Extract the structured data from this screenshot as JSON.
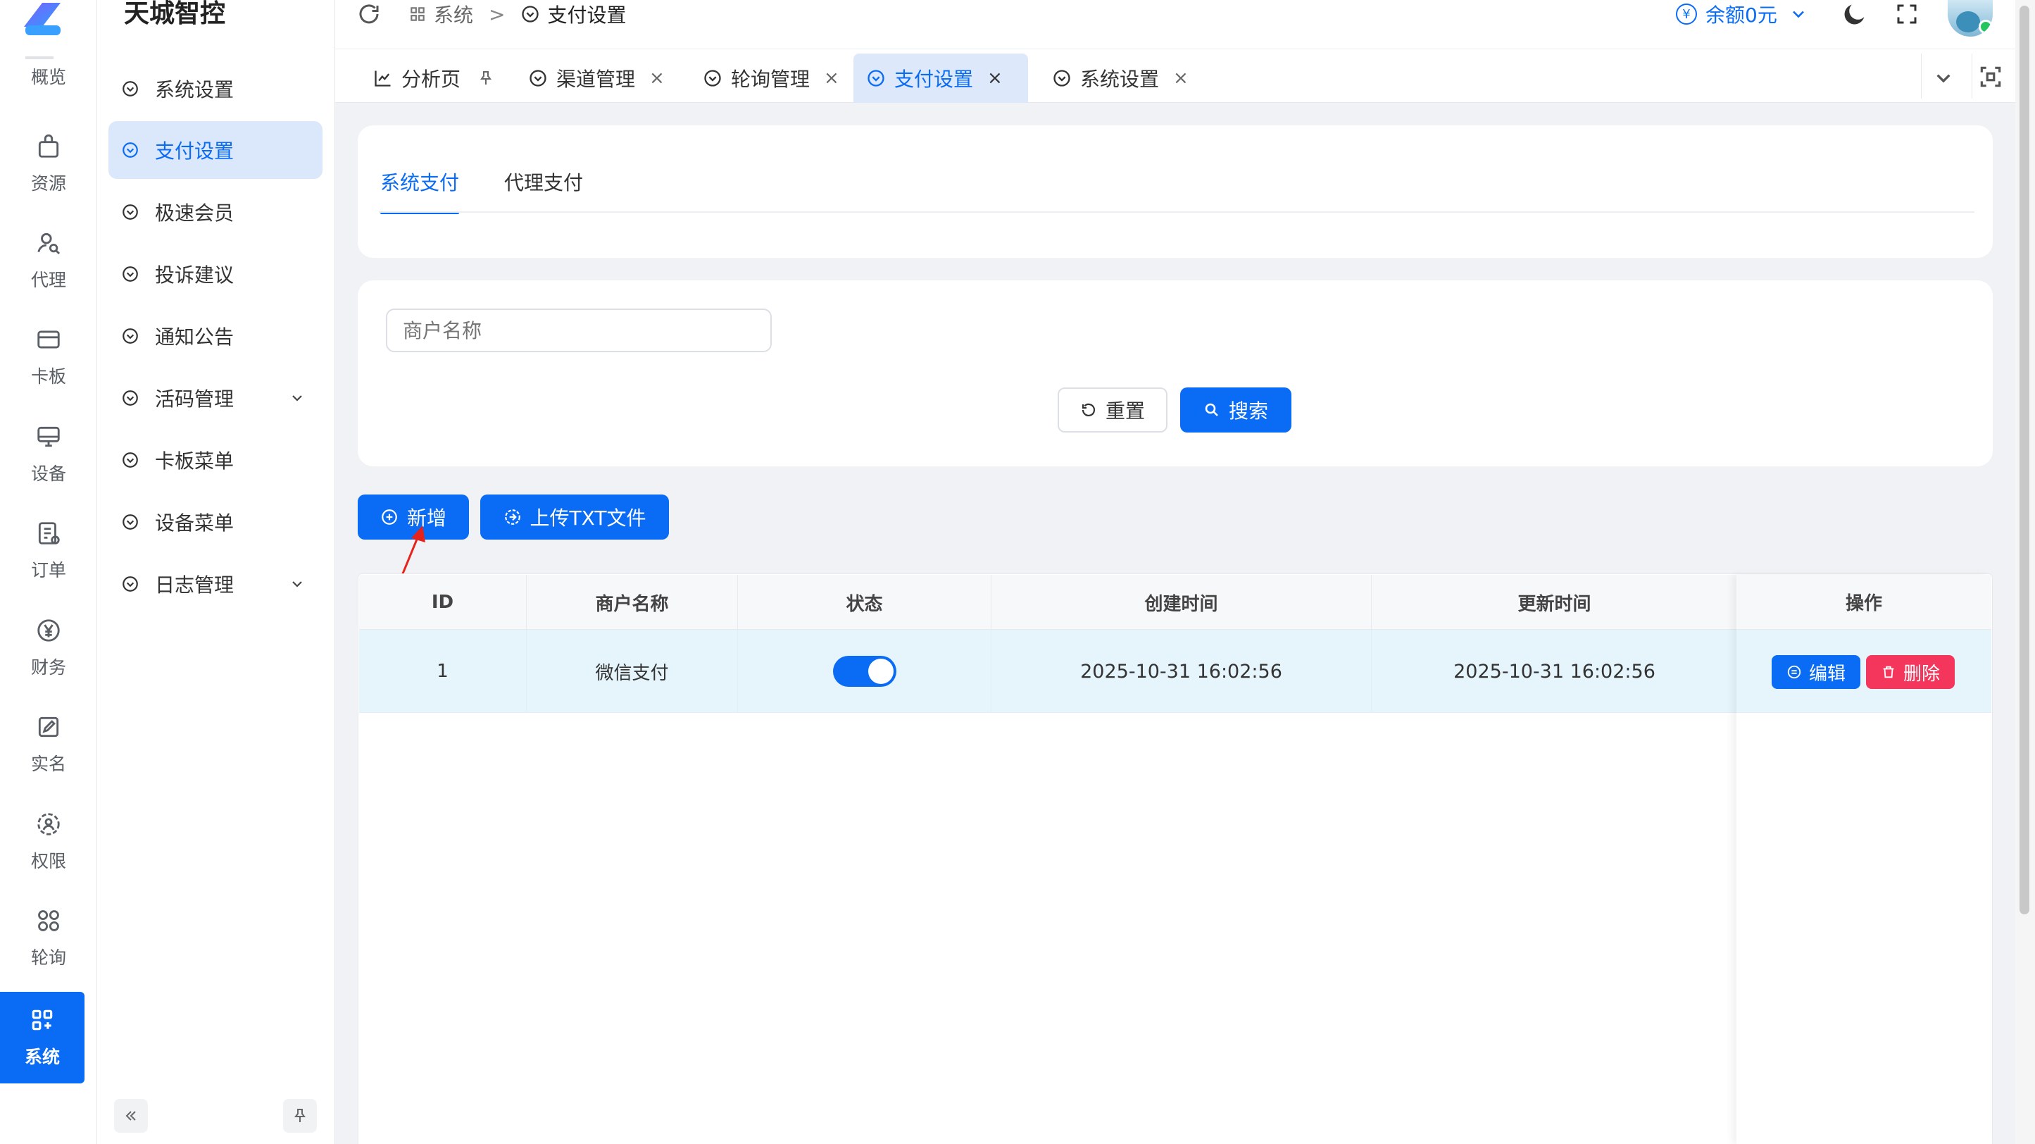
{
  "app": {
    "title": "天城智控"
  },
  "rail": [
    {
      "label": "概览",
      "icon": "overview-icon"
    },
    {
      "label": "资源",
      "icon": "bag-icon"
    },
    {
      "label": "代理",
      "icon": "user-search-icon"
    },
    {
      "label": "卡板",
      "icon": "card-icon"
    },
    {
      "label": "设备",
      "icon": "monitor-icon"
    },
    {
      "label": "订单",
      "icon": "order-icon"
    },
    {
      "label": "财务",
      "icon": "yuan-icon"
    },
    {
      "label": "实名",
      "icon": "edit-icon"
    },
    {
      "label": "权限",
      "icon": "permission-icon"
    },
    {
      "label": "轮询",
      "icon": "grid-circles-icon"
    },
    {
      "label": "系统",
      "icon": "grid-plus-icon"
    }
  ],
  "submenu": [
    {
      "label": "系统设置"
    },
    {
      "label": "支付设置"
    },
    {
      "label": "极速会员"
    },
    {
      "label": "投诉建议"
    },
    {
      "label": "通知公告"
    },
    {
      "label": "活码管理"
    },
    {
      "label": "卡板菜单"
    },
    {
      "label": "设备菜单"
    },
    {
      "label": "日志管理"
    }
  ],
  "breadcrumb": {
    "parent": "系统",
    "sep": ">",
    "current": "支付设置"
  },
  "header": {
    "balance": "余额0元",
    "currency_symbol": "¥"
  },
  "tabs": [
    {
      "label": "分析页"
    },
    {
      "label": "渠道管理"
    },
    {
      "label": "轮询管理"
    },
    {
      "label": "支付设置"
    },
    {
      "label": "系统设置"
    }
  ],
  "close_glyph": "×",
  "subtabs": {
    "system": "系统支付",
    "agent": "代理支付"
  },
  "search": {
    "placeholder": "商户名称",
    "reset": "重置",
    "submit": "搜索"
  },
  "actions": {
    "add": "新增",
    "upload": "上传TXT文件"
  },
  "table": {
    "headers": [
      "ID",
      "商户名称",
      "状态",
      "创建时间",
      "更新时间",
      "操作"
    ],
    "rows": [
      {
        "id": "1",
        "name": "微信支付",
        "status_on": true,
        "created": "2025-10-31 16:02:56",
        "updated": "2025-10-31 16:02:56",
        "edit": "编辑",
        "delete": "删除"
      }
    ]
  },
  "colors": {
    "primary": "#0a6cf5",
    "danger": "#f5365c",
    "annotation": "#e5231b"
  }
}
